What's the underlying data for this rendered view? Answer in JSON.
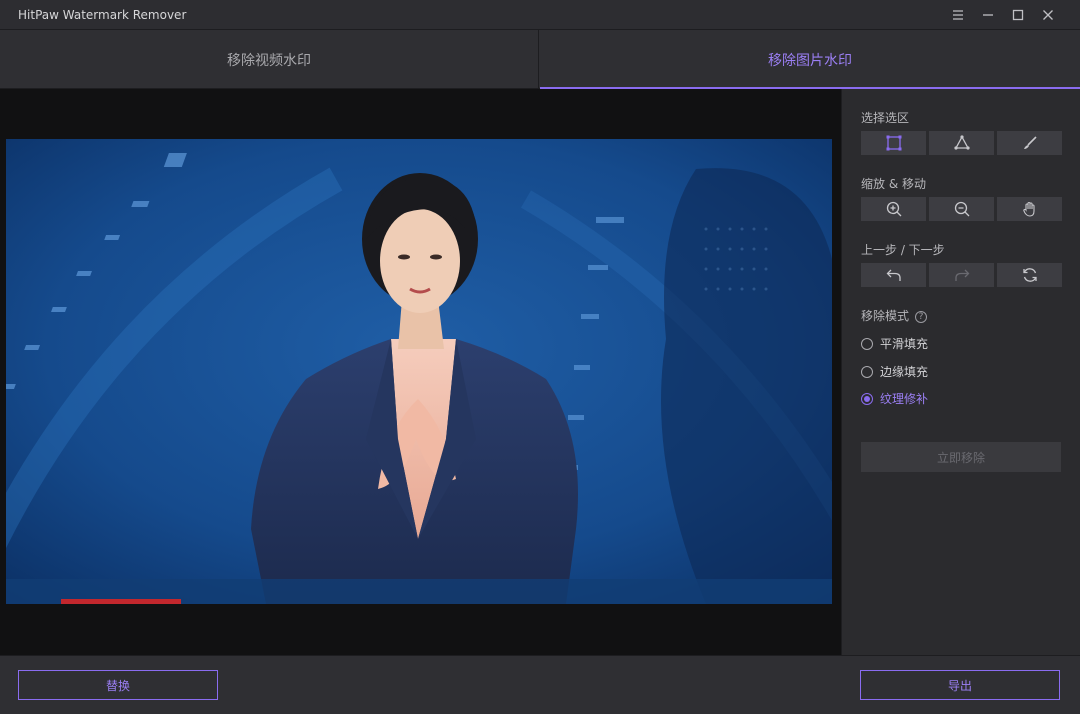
{
  "window": {
    "title": "HitPaw Watermark Remover",
    "controls": [
      "menu-icon",
      "minimize-icon",
      "maximize-icon",
      "close-icon"
    ]
  },
  "tabs": [
    {
      "label": "移除视频水印",
      "active": false
    },
    {
      "label": "移除图片水印",
      "active": true
    }
  ],
  "panel": {
    "select_area": {
      "title": "选择选区",
      "tools": [
        "rectangle-select-icon",
        "polygon-select-icon",
        "brush-select-icon"
      ]
    },
    "zoom_move": {
      "title": "缩放 & 移动",
      "tools": [
        "zoom-in-icon",
        "zoom-out-icon",
        "hand-pan-icon"
      ]
    },
    "undo_redo": {
      "title": "上一步 / 下一步",
      "tools": [
        "undo-icon",
        "redo-icon",
        "reset-icon"
      ]
    },
    "remove_mode": {
      "title": "移除模式",
      "help": "?",
      "options": [
        {
          "label": "平滑填充",
          "selected": false
        },
        {
          "label": "边缘填充",
          "selected": false
        },
        {
          "label": "纹理修补",
          "selected": true
        }
      ]
    },
    "remove_now": "立即移除"
  },
  "bottom": {
    "replace": "替换",
    "export": "导出"
  },
  "colors": {
    "accent": "#8a6cf0",
    "background": "#2b2b2e",
    "preview_bg": "#111112"
  }
}
